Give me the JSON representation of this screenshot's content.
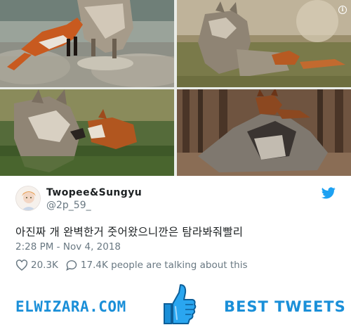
{
  "tweet": {
    "display_name": "Twopee&Sungyu",
    "handle": "@2p_59_",
    "text": "아진짜 개 완벽한거 줏어왔으니깐은 탐라봐줘빨리",
    "timestamp": "2:28 PM - Nov 4, 2018",
    "likes": "20.3K",
    "talking": "17.4K people are talking about this",
    "twitter_color": "#1da1f2"
  },
  "photos": [
    {
      "name": "fox-and-wolf-on-rocks"
    },
    {
      "name": "wolf-and-fox-in-grass"
    },
    {
      "name": "wolf-sniffing-fox"
    },
    {
      "name": "fox-on-wolf-in-forest"
    }
  ],
  "footer": {
    "left_text": "ELWIZARA.COM",
    "right_text": "BEST TWEETS",
    "accent": "#1a8fd8"
  }
}
